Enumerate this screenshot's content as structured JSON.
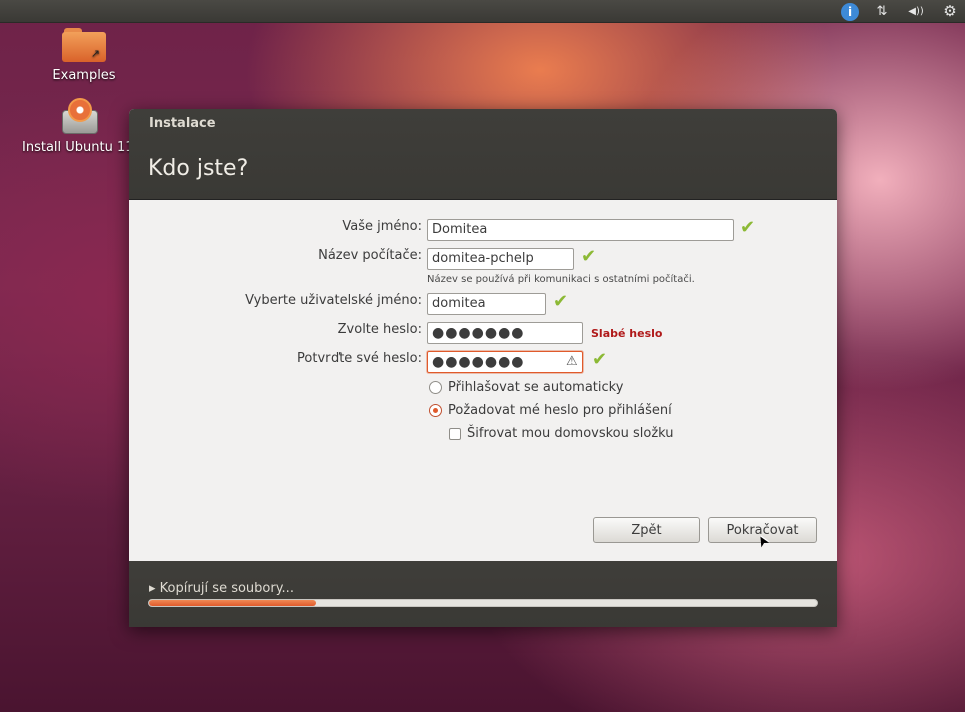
{
  "colors": {
    "accent": "#e05a2b",
    "check": "#8cb935",
    "weak": "#b01919",
    "header_bg": "#3c3b37"
  },
  "panel": {
    "icons": [
      "accessibility-icon",
      "network-icon",
      "volume-icon",
      "system-gear-icon"
    ],
    "accessibility": "i",
    "network": "⇅",
    "volume": "◀))",
    "system": "⚙"
  },
  "desktop": {
    "examples_label": "Examples",
    "install_label": "Install Ubuntu 11."
  },
  "window": {
    "title": "Instalace",
    "page_title": "Kdo jste?",
    "form": {
      "name_label": "Vaše jméno:",
      "name_value": "Domitea",
      "computer_label": "Název počítače:",
      "computer_value": "domitea-pchelp",
      "computer_hint": "Název se používá při komunikaci s ostatními počítači.",
      "username_label": "Vyberte uživatelské jméno:",
      "username_value": "domitea",
      "password_label": "Zvolte heslo:",
      "password_value": "●●●●●●●",
      "password_strength": "Slabé heslo",
      "confirm_label": "Potvrďte své heslo:",
      "confirm_value": "●●●●●●●",
      "auto_login_label": "Přihlašovat se automaticky",
      "require_password_label": "Požadovat mé heslo pro přihlášení",
      "encrypt_label": "Šifrovat mou domovskou složku",
      "selected_option": "require_password",
      "encrypt_checked": false
    },
    "buttons": {
      "back": "Zpět",
      "continue": "Pokračovat"
    },
    "footer": {
      "status": "▸ Kopírují se soubory...",
      "progress_fraction": 0.25
    }
  }
}
